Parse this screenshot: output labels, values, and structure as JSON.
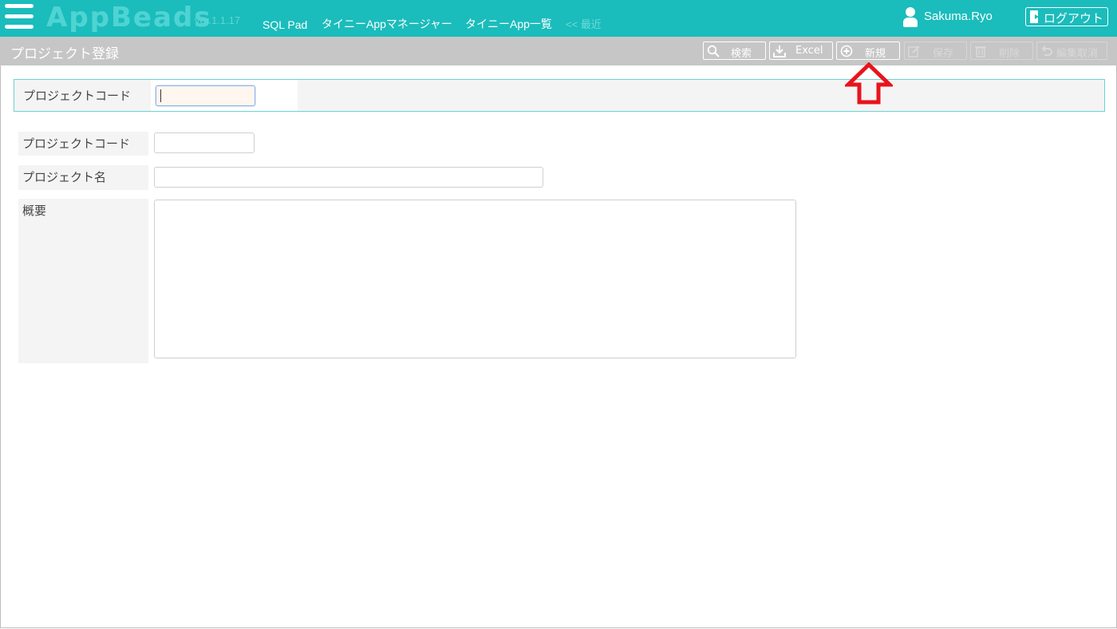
{
  "header": {
    "logo": "AppBeads",
    "version": "ver.1.1.17",
    "nav": {
      "sql_pad": "SQL Pad",
      "tiny_app_manager": "タイニーAppマネージャー",
      "tiny_app_list": "タイニーApp一覧",
      "recent": "<< 最近"
    },
    "user_name": "Sakuma.Ryo",
    "logout_label": "ログアウト"
  },
  "toolbar": {
    "title": "プロジェクト登録",
    "buttons": {
      "search": "検索",
      "excel": "Excel",
      "new": "新規",
      "save": "保存",
      "delete": "削除",
      "cancel_edit": "編集取消"
    }
  },
  "search_panel": {
    "label": "プロジェクトコード",
    "value": ""
  },
  "form": {
    "project_code_label": "プロジェクトコード",
    "project_code_value": "",
    "project_name_label": "プロジェクト名",
    "project_name_value": "",
    "description_label": "概要",
    "description_value": ""
  },
  "colors": {
    "header": "#1bbcbc",
    "toolbar": "#c6c6c6",
    "annotation_arrow": "#e8141c"
  }
}
